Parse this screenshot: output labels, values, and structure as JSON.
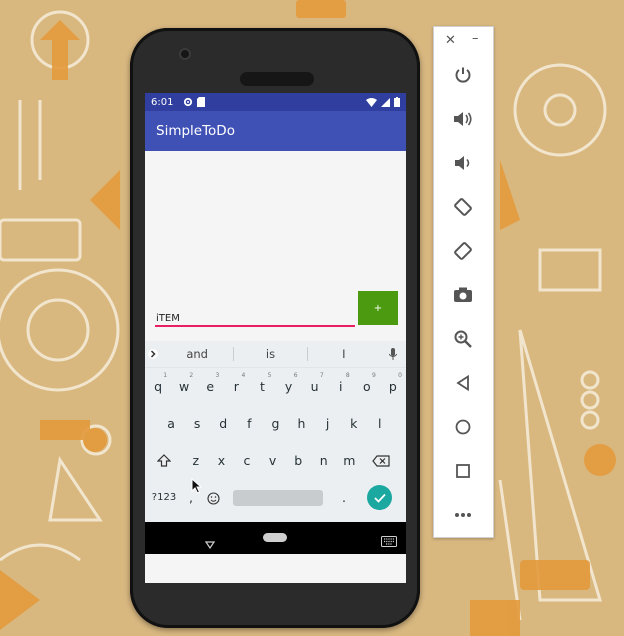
{
  "status_bar": {
    "time": "6:01"
  },
  "app": {
    "title": "SimpleToDo"
  },
  "item_input": {
    "value": "iTEM",
    "placeholder": ""
  },
  "add_button": {
    "label": "+"
  },
  "keyboard": {
    "suggestions": [
      "and",
      "is",
      "I"
    ],
    "row1": [
      {
        "key": "q",
        "hint": "1"
      },
      {
        "key": "w",
        "hint": "2"
      },
      {
        "key": "e",
        "hint": "3"
      },
      {
        "key": "r",
        "hint": "4"
      },
      {
        "key": "t",
        "hint": "5"
      },
      {
        "key": "y",
        "hint": "6"
      },
      {
        "key": "u",
        "hint": "7"
      },
      {
        "key": "i",
        "hint": "8"
      },
      {
        "key": "o",
        "hint": "9"
      },
      {
        "key": "p",
        "hint": "0"
      }
    ],
    "row2": [
      "a",
      "s",
      "d",
      "f",
      "g",
      "h",
      "j",
      "k",
      "l"
    ],
    "row3": [
      "z",
      "x",
      "c",
      "v",
      "b",
      "n",
      "m"
    ],
    "symbols_key": "?123",
    "comma_key": ",",
    "period_key": "."
  },
  "emulator_controls": [
    "close",
    "minimize",
    "power",
    "volume-up",
    "volume-down",
    "rotate-left",
    "rotate-right",
    "screenshot",
    "zoom",
    "back",
    "home",
    "overview",
    "more"
  ],
  "colors": {
    "status_bar": "#303f9f",
    "app_bar": "#3f51b5",
    "accent": "#e91e63",
    "add_button": "#4c9a10",
    "enter_key": "#1aa8a0"
  }
}
